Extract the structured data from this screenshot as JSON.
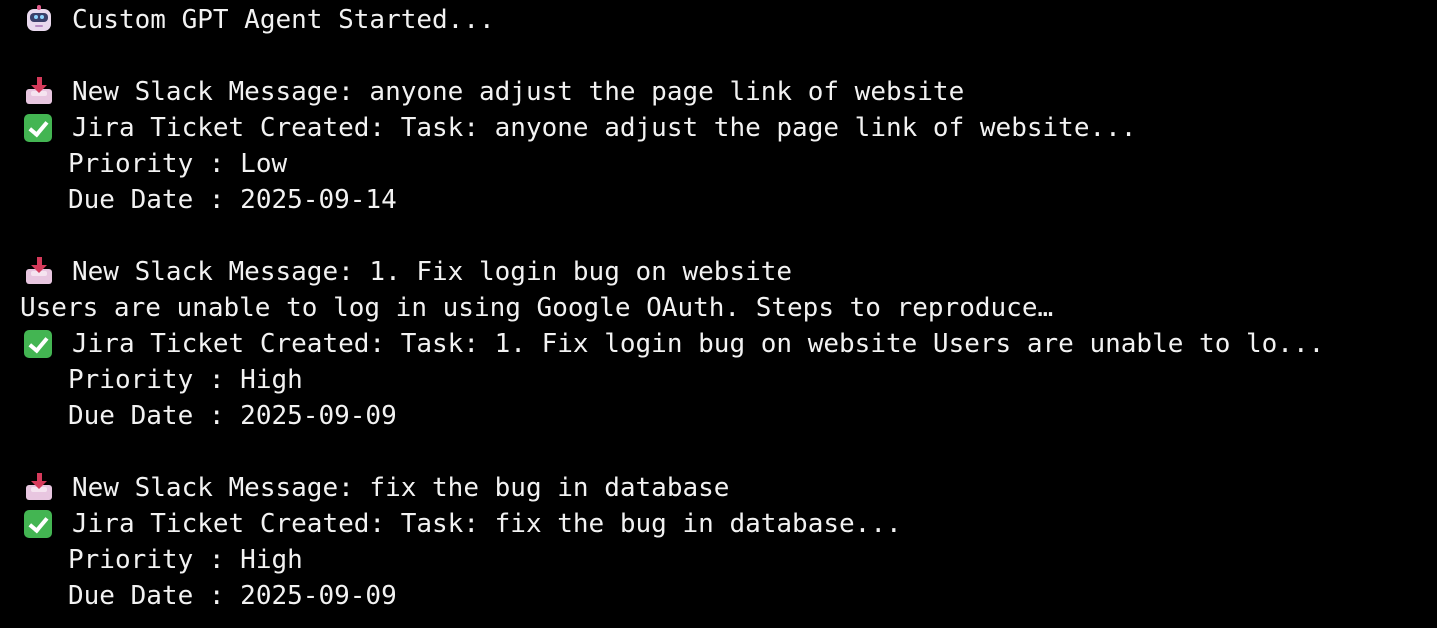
{
  "terminal": {
    "header": "Custom GPT Agent Started...",
    "entries": [
      {
        "message": "New Slack Message: anyone adjust the page link of website",
        "message_cont": "",
        "ticket": "Jira Ticket Created: Task: anyone adjust the page link of website...",
        "priority": "Priority : Low",
        "due": "Due Date : 2025-09-14"
      },
      {
        "message": "New Slack Message: 1. Fix login bug on website",
        "message_cont": "Users are unable to log in using Google OAuth. Steps to reproduce…",
        "ticket": "Jira Ticket Created: Task: 1. Fix login bug on website Users are unable to lo...",
        "priority": "Priority : High",
        "due": "Due Date : 2025-09-09"
      },
      {
        "message": "New Slack Message: fix the bug in database",
        "message_cont": "",
        "ticket": "Jira Ticket Created: Task: fix the bug in database...",
        "priority": "Priority : High",
        "due": "Due Date : 2025-09-09"
      }
    ]
  },
  "icons": {
    "header": "robot-icon",
    "message": "inbox-tray-icon",
    "ticket": "check-mark-icon"
  },
  "colors": {
    "background": "#000000",
    "text": "#f2f2f2",
    "check": "#43b552"
  }
}
